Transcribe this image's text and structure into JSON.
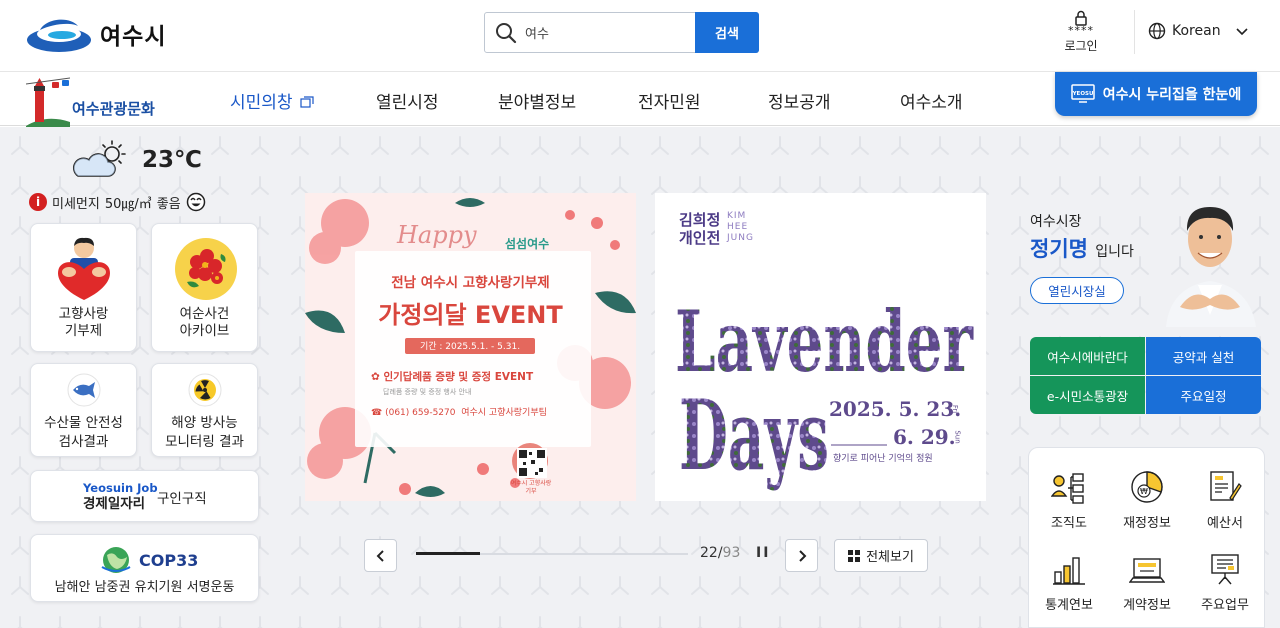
{
  "header": {
    "logo_text": "여수시",
    "search_value": "여수",
    "search_button": "검색",
    "login_stars": "****",
    "login_label": "로그인",
    "language": "Korean"
  },
  "nav": {
    "tour_label": "여수관광문화",
    "items": [
      {
        "label": "시민의창",
        "active": true
      },
      {
        "label": "열린시정"
      },
      {
        "label": "분야별정보"
      },
      {
        "label": "전자민원"
      },
      {
        "label": "정보공개"
      },
      {
        "label": "여수소개"
      }
    ],
    "portal_button": "여수시 누리집을 한눈에",
    "portal_badge": "YEOSU"
  },
  "weather": {
    "temperature": "23℃",
    "dust_prefix": "미세먼지",
    "dust_value": "50㎍/㎥",
    "dust_status": "좋음"
  },
  "quick_links": {
    "hometown_line1": "고향사랑",
    "hometown_line2": "기부제",
    "archive_line1": "여순사건",
    "archive_line2": "아카이브",
    "seafood_line1": "수산물 안전성",
    "seafood_line2": "검사결과",
    "radiation_line1": "해양 방사능",
    "radiation_line2": "모니터링 결과",
    "job_brand_en": "Yeosuin Job",
    "job_brand_ko": "경제일자리",
    "job_label": "구인구직",
    "cop_brand": "COP33",
    "cop_label": "남해안 남중권 유치기원 서명운동"
  },
  "banner1": {
    "script": "Happy",
    "brand": "섬섬여수",
    "subtitle": "전남 여수시 고향사랑기부제",
    "title": "가정의달 EVENT",
    "period": "기간 : 2025.5.1. - 5.31.",
    "desc": "인기답례품 증량 및 증정 EVENT",
    "fine_print": "답례품 증량 및 증정 행사 안내",
    "phone": "(061) 659-5270",
    "dept": "여수시 고향사랑기부팀",
    "qr_caption": "여수시 고향사랑기부"
  },
  "banner2": {
    "artist_ko_line1": "김희정",
    "artist_ko_line2": "개인전",
    "artist_en_1": "KIM",
    "artist_en_2": "HEE",
    "artist_en_3": "JUNG",
    "title_line1": "Lavender",
    "title_line2": "Days",
    "date_start": "2025. 5. 23.",
    "date_start_day": "Fri",
    "date_end": "6. 29.",
    "date_end_day": "Sun",
    "tagline": "향기로 피어난 기억의 정원"
  },
  "slider": {
    "current": "22",
    "total": "93",
    "position_fraction": 0.2366,
    "pause_symbol": "II",
    "view_all": "전체보기"
  },
  "mayor": {
    "title": "여수시장",
    "name": "정기명",
    "suffix": "입니다",
    "office_button": "열린시장실"
  },
  "mayor_links": [
    {
      "label": "여수시에바란다",
      "color": "#15955a"
    },
    {
      "label": "공약과 실천",
      "color": "#1a6fd8"
    },
    {
      "label": "e-시민소통광장",
      "color": "#15955a"
    },
    {
      "label": "주요일정",
      "color": "#1a6fd8"
    }
  ],
  "info_icons": {
    "org": "조직도",
    "finance": "재정정보",
    "budget": "예산서",
    "stats": "통계연보",
    "contract": "계약정보",
    "work": "주요업무"
  },
  "colors": {
    "primary_blue": "#1a6fd8",
    "green": "#15955a",
    "background": "#f0f1f4"
  }
}
